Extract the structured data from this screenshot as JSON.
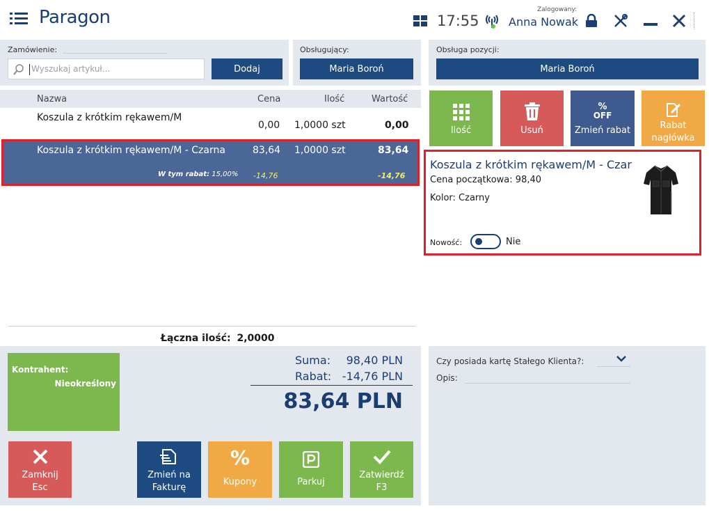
{
  "app": {
    "title": "Paragon"
  },
  "topbar": {
    "time": "17:55",
    "logged_label": "Zalogowany:",
    "user": "Anna Nowak"
  },
  "order": {
    "label": "Zamówienie:",
    "search_placeholder": "Wyszukaj artykuł...",
    "add_label": "Dodaj"
  },
  "serving": {
    "label": "Obsługujący:",
    "value": "Maria Boroń"
  },
  "item_service": {
    "label": "Obsługa pozycji:",
    "value": "Maria Boroń"
  },
  "table": {
    "columns": {
      "name": "Nazwa",
      "price": "Cena",
      "qty": "Ilość",
      "value": "Wartość"
    },
    "rows": [
      {
        "name": "Koszula z krótkim rękawem/M",
        "price": "0,00",
        "qty": "1,0000 szt",
        "value": "0,00"
      },
      {
        "name": "Koszula z krótkim rękawem/M - Czarna",
        "price": "83,64",
        "qty": "1,0000 szt",
        "value": "83,64",
        "discount_label": "W tym rabat:",
        "discount_pct": "15,00%",
        "discount_price": "-14,76",
        "discount_value": "-14,76"
      }
    ],
    "total_qty_label": "Łączna ilość:",
    "total_qty": "2,0000"
  },
  "actions": {
    "qty": "Ilość",
    "delete": "Usuń",
    "change_discount": "Zmień rabat",
    "header_discount_1": "Rabat",
    "header_discount_2": "nagłówka",
    "off_text": "OFF"
  },
  "detail": {
    "name": "Koszula z krótkim rękawem/M - Czar",
    "price_label": "Cena początkowa:",
    "price": "98,40",
    "color_label": "Kolor:",
    "color": "Czarny",
    "new_label": "Nowość:",
    "new_value": "Nie"
  },
  "contractor": {
    "label": "Kontrahent:",
    "value": "Nieokreślony"
  },
  "summary": {
    "sum_label": "Suma:",
    "sum": "98,40 PLN",
    "discount_label": "Rabat:",
    "discount": "-14,76 PLN",
    "total": "83,64 PLN"
  },
  "loyalty": {
    "question": "Czy posiada kartę Stałego Klienta?:",
    "desc_label": "Opis:"
  },
  "bottom": {
    "close_1": "Zamknij",
    "close_2": "Esc",
    "invoice_1": "Zmień na",
    "invoice_2": "Fakturę",
    "coupons": "Kupony",
    "park": "Parkuj",
    "confirm_1": "Zatwierdź",
    "confirm_2": "F3"
  },
  "colors": {
    "accent": "#1e4a82",
    "selected_row": "#4a6797",
    "highlight_border": "#e0202a",
    "green": "#7cb84d",
    "red": "#d65a5a",
    "orange": "#f0a945"
  }
}
